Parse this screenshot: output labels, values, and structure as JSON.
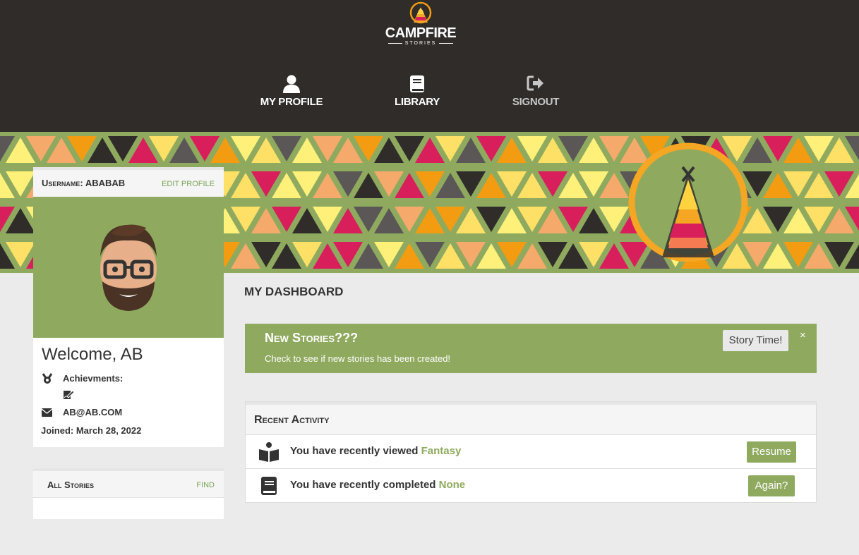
{
  "brand": {
    "name": "CAMPFIRE",
    "tagline": "STORIES"
  },
  "nav": {
    "profile": "MY PROFILE",
    "library": "LIBRARY",
    "signout": "SIGNOUT"
  },
  "profile": {
    "username_label": "Username: ABABAB",
    "edit_label": "EDIT PROFILE",
    "welcome": "Welcome, AB",
    "achievements_label": "Achievments:",
    "email": "AB@AB.COM",
    "joined": "Joined: March 28, 2022"
  },
  "stories_card": {
    "title": "All Stories",
    "find_label": "FIND"
  },
  "dashboard": {
    "title": "MY DASHBOARD",
    "alert": {
      "title": "New Stories???",
      "text": "Check to see if new stories has been created!",
      "button": "Story Time!",
      "close": "×"
    },
    "activity": {
      "title": "Recent Activity",
      "rows": [
        {
          "prefix": "You have recently viewed ",
          "highlight": "Fantasy",
          "button": "Resume",
          "icon": "book-open-icon"
        },
        {
          "prefix": "You have recently completed ",
          "highlight": "None",
          "button": "Again?",
          "icon": "book-icon"
        }
      ]
    }
  },
  "colors": {
    "header": "#302c29",
    "accent": "#8faa5f",
    "background": "#ebebeb"
  }
}
